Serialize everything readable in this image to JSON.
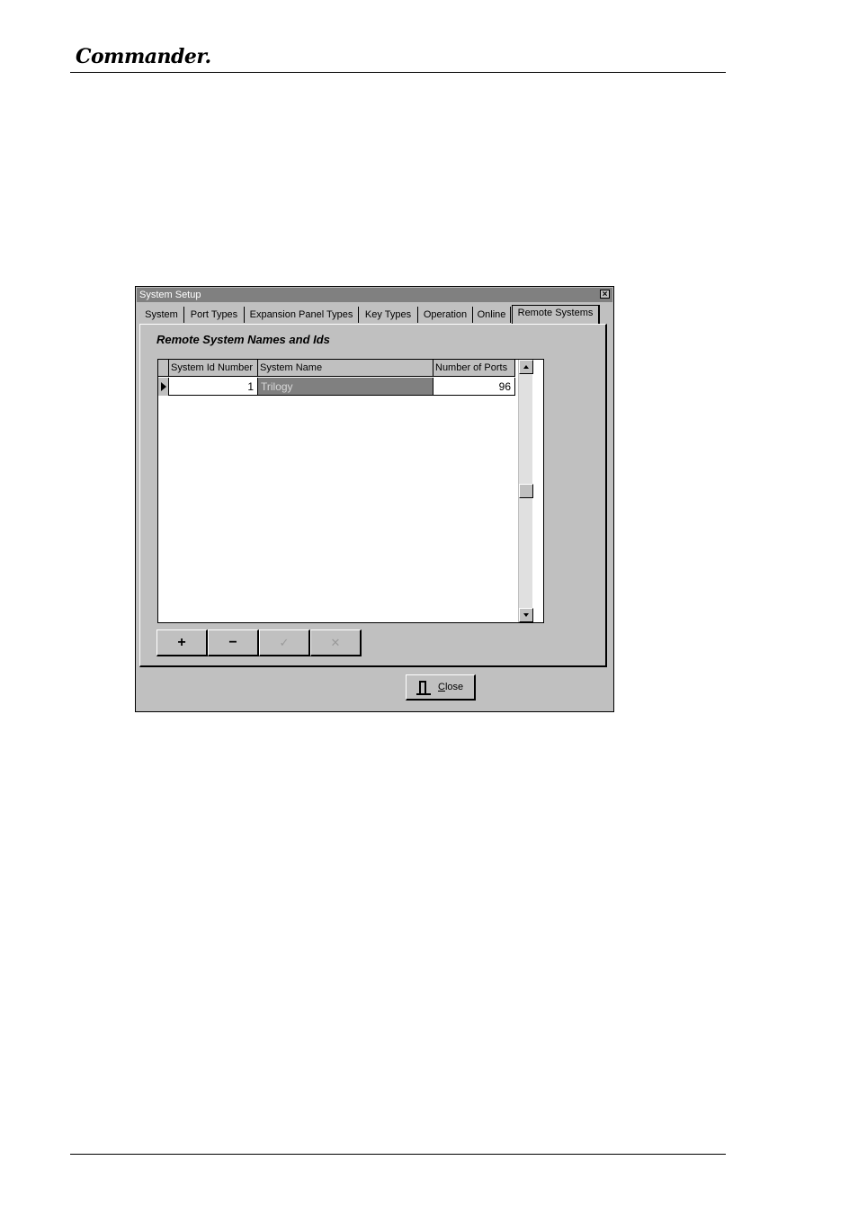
{
  "page": {
    "logo_text": "Commander."
  },
  "dialog": {
    "title": "System Setup",
    "close_glyph": "×",
    "tabs": [
      {
        "label": "System"
      },
      {
        "label": "Port Types"
      },
      {
        "label": "Expansion Panel Types"
      },
      {
        "label": "Key Types"
      },
      {
        "label": "Operation"
      },
      {
        "label": "Online"
      },
      {
        "label": "Remote Systems"
      }
    ],
    "active_tab": "Remote Systems",
    "heading": "Remote System Names and Ids",
    "grid": {
      "columns": [
        "System Id Number",
        "System Name",
        "Number of Ports"
      ],
      "rows": [
        {
          "id": "1",
          "name": "Trilogy",
          "ports": "96"
        }
      ]
    },
    "navigator": {
      "add": "+",
      "remove": "−",
      "post": "✓",
      "cancel": "✕"
    },
    "close_button": {
      "mnemonic": "C",
      "rest": "lose"
    }
  }
}
